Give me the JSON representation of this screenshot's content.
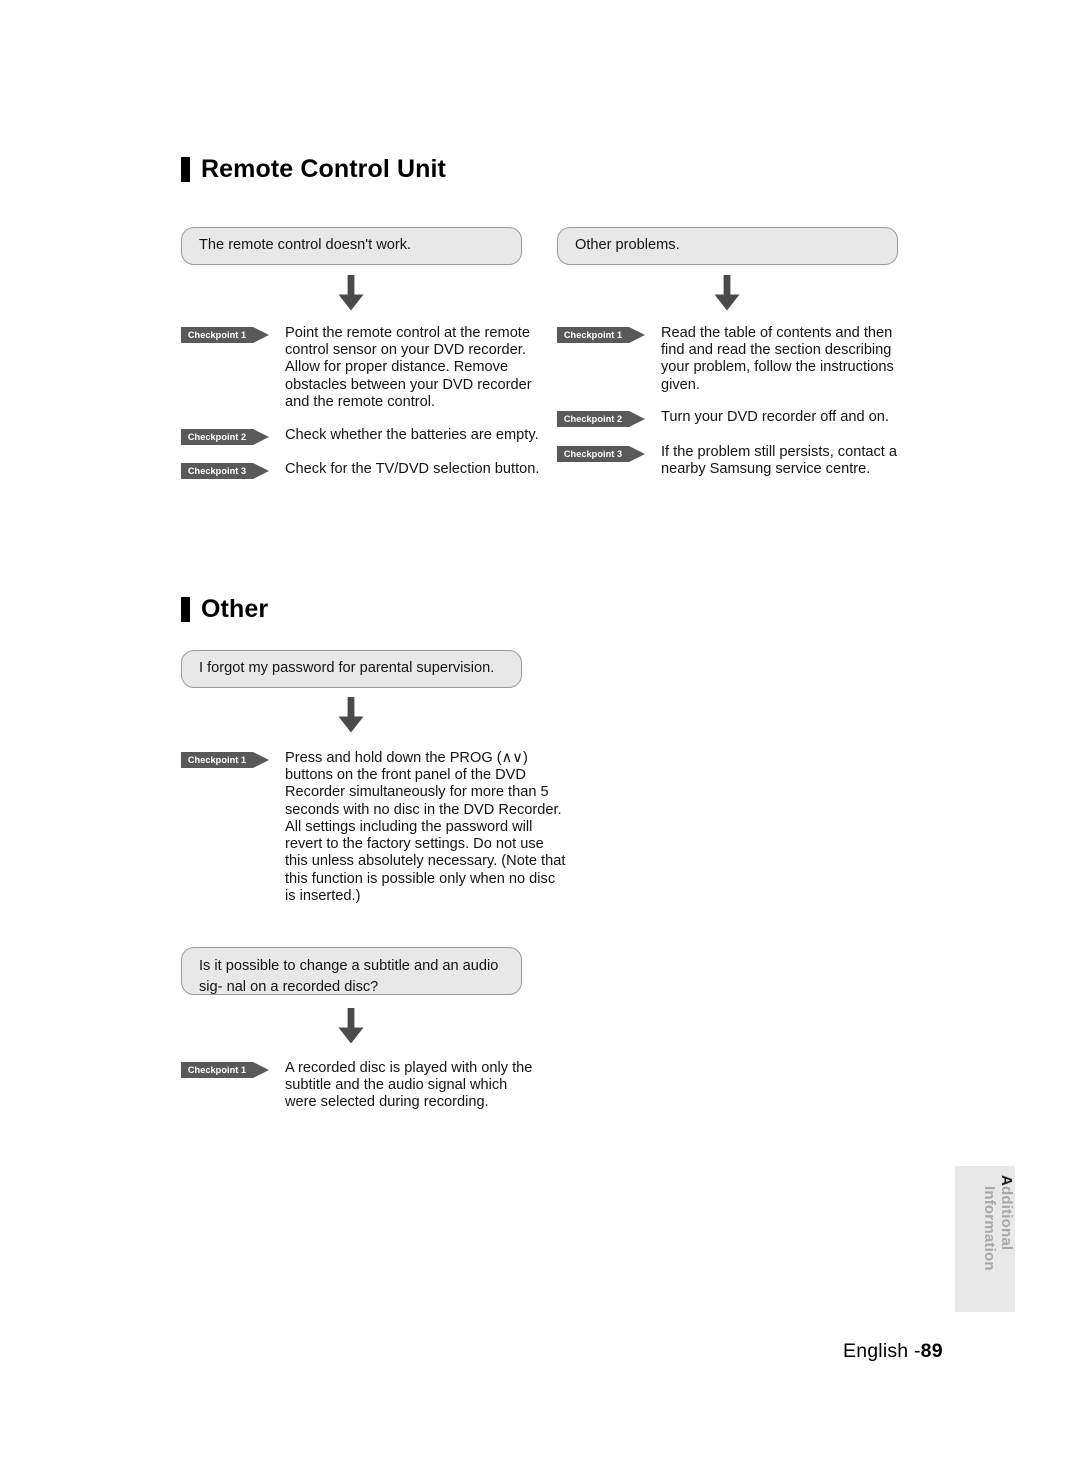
{
  "page": {
    "footer_language": "English -",
    "footer_page_number": "89",
    "side_tab_label": "Additional Information",
    "side_tab_label_first": "A",
    "side_tab_label_rest": "dditional Information"
  },
  "colors": {
    "bubble_fill": "#e8e8e8",
    "bubble_border": "#9a9a9a",
    "badge_fill": "#595959",
    "badge_text": "#ffffff",
    "arrow": "#4a4a4a",
    "heading_bar": "#000000",
    "side_tab_fill": "#e8e8e8",
    "side_tab_text": "#a8a8a8"
  },
  "sections": [
    {
      "id": "remote-control-unit",
      "heading": "Remote Control Unit",
      "columns": [
        {
          "id": "remote-doesnt-work",
          "question": "The remote control doesn't work.",
          "arrow_icon": "arrow-down-icon",
          "checkpoints": [
            {
              "badge": "Checkpoint 1",
              "lines": [
                "Point the remote control at the remote",
                "control sensor on your DVD recorder.",
                "Allow for proper distance. Remove",
                "obstacles between your DVD recorder",
                "and the remote control."
              ]
            },
            {
              "badge": "Checkpoint 2",
              "lines": [
                "Check whether the batteries are empty."
              ]
            },
            {
              "badge": "Checkpoint 3",
              "lines": [
                "Check for the TV/DVD selection button."
              ]
            }
          ]
        },
        {
          "id": "other-problems",
          "question": "Other problems.",
          "arrow_icon": "arrow-down-icon",
          "checkpoints": [
            {
              "badge": "Checkpoint 1",
              "lines": [
                "Read the table of contents and then",
                "find and read the section describing",
                "your problem, follow the instructions",
                "given."
              ]
            },
            {
              "badge": "Checkpoint 2",
              "lines": [
                "Turn your DVD recorder off and on."
              ]
            },
            {
              "badge": "Checkpoint 3",
              "lines": [
                "If the problem still persists, contact a",
                "nearby Samsung service centre."
              ]
            }
          ]
        }
      ]
    },
    {
      "id": "other",
      "heading": "Other",
      "columns": [
        {
          "id": "forgot-password",
          "question": "I forgot my password for parental supervision.",
          "arrow_icon": "arrow-down-icon",
          "checkpoints": [
            {
              "badge": "Checkpoint 1",
              "lines": [
                "Press and hold down the PROG (∧∨)",
                "buttons on the front panel of the DVD",
                "Recorder simultaneously for more than 5",
                "seconds with no disc in the DVD Recorder.",
                "All settings including the password will",
                "revert to the factory settings. Do not use",
                "this unless absolutely necessary. (Note that",
                "this function is possible only when no disc",
                "is inserted.)"
              ]
            }
          ]
        },
        {
          "id": "change-subtitle-audio",
          "question_line_1": "Is it possible to change a subtitle and an audio sig-",
          "question_line_2": "nal on a recorded disc?",
          "arrow_icon": "arrow-down-icon",
          "checkpoints": [
            {
              "badge": "Checkpoint 1",
              "lines": [
                "A recorded disc is played with only the",
                "subtitle and the audio signal which",
                "were selected during recording."
              ]
            }
          ]
        }
      ]
    }
  ]
}
